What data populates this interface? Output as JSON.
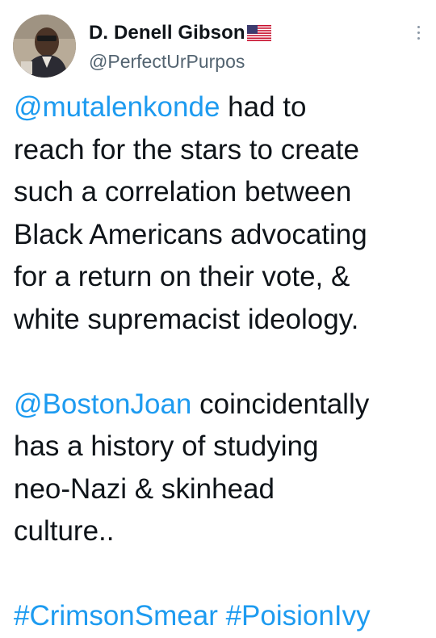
{
  "author": {
    "display_name": "D. Denell Gibson",
    "flag_icon": "us-flag-icon",
    "handle": "@PerfectUrPurpos"
  },
  "tweet": {
    "paragraph1": {
      "mention": "@mutalenkonde",
      "line1_rest": " had to",
      "line2": "reach for the stars to create",
      "line3": "such a correlation between",
      "line4": "Black Americans advocating",
      "line5": "for a return on their vote, &",
      "line6": "white supremacist ideology."
    },
    "paragraph2": {
      "mention": "@BostonJoan",
      "line1_rest": " coincidentally",
      "line2": "has a history of studying",
      "line3": "neo-Nazi & skinhead",
      "line4": "culture.."
    },
    "hashtags": [
      "#CrimsonSmear",
      "#PoisionIvy"
    ]
  },
  "colors": {
    "link": "#1d9bf0",
    "text": "#0f1419",
    "secondary": "#536471"
  }
}
